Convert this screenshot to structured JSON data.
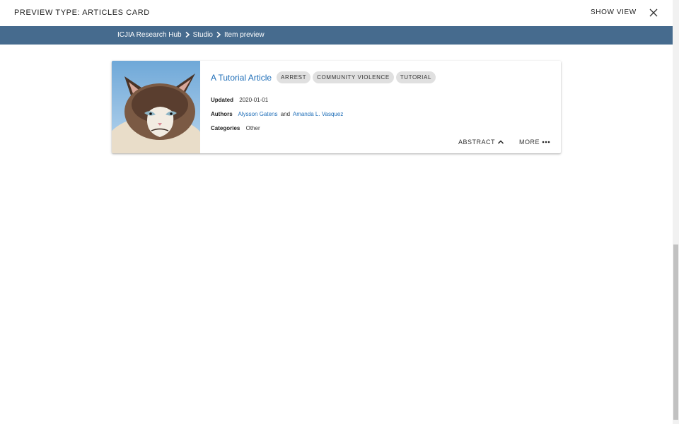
{
  "header": {
    "title": "PREVIEW TYPE: ARTICLES CARD",
    "show_view_label": "SHOW VIEW",
    "close_icon": "close-icon"
  },
  "breadcrumb": {
    "items": [
      "ICJIA Research Hub",
      "Studio",
      "Item preview"
    ],
    "separator_icon": "chevron-right-icon",
    "bar_color": "#466b8e"
  },
  "card": {
    "image_icon": "grumpy-cat-thumbnail",
    "title": "A Tutorial Article",
    "tags": [
      "ARREST",
      "COMMUNITY VIOLENCE",
      "TUTORIAL"
    ],
    "updated_label": "Updated",
    "updated_value": "2020-01-01",
    "authors_label": "Authors",
    "authors": [
      "Alysson Gatens",
      "Amanda L. Vasquez"
    ],
    "authors_joiner": "and",
    "categories_label": "Categories",
    "categories_value": "Other",
    "abstract_label": "ABSTRACT",
    "more_label": "MORE",
    "link_color": "#1f6eb8"
  }
}
